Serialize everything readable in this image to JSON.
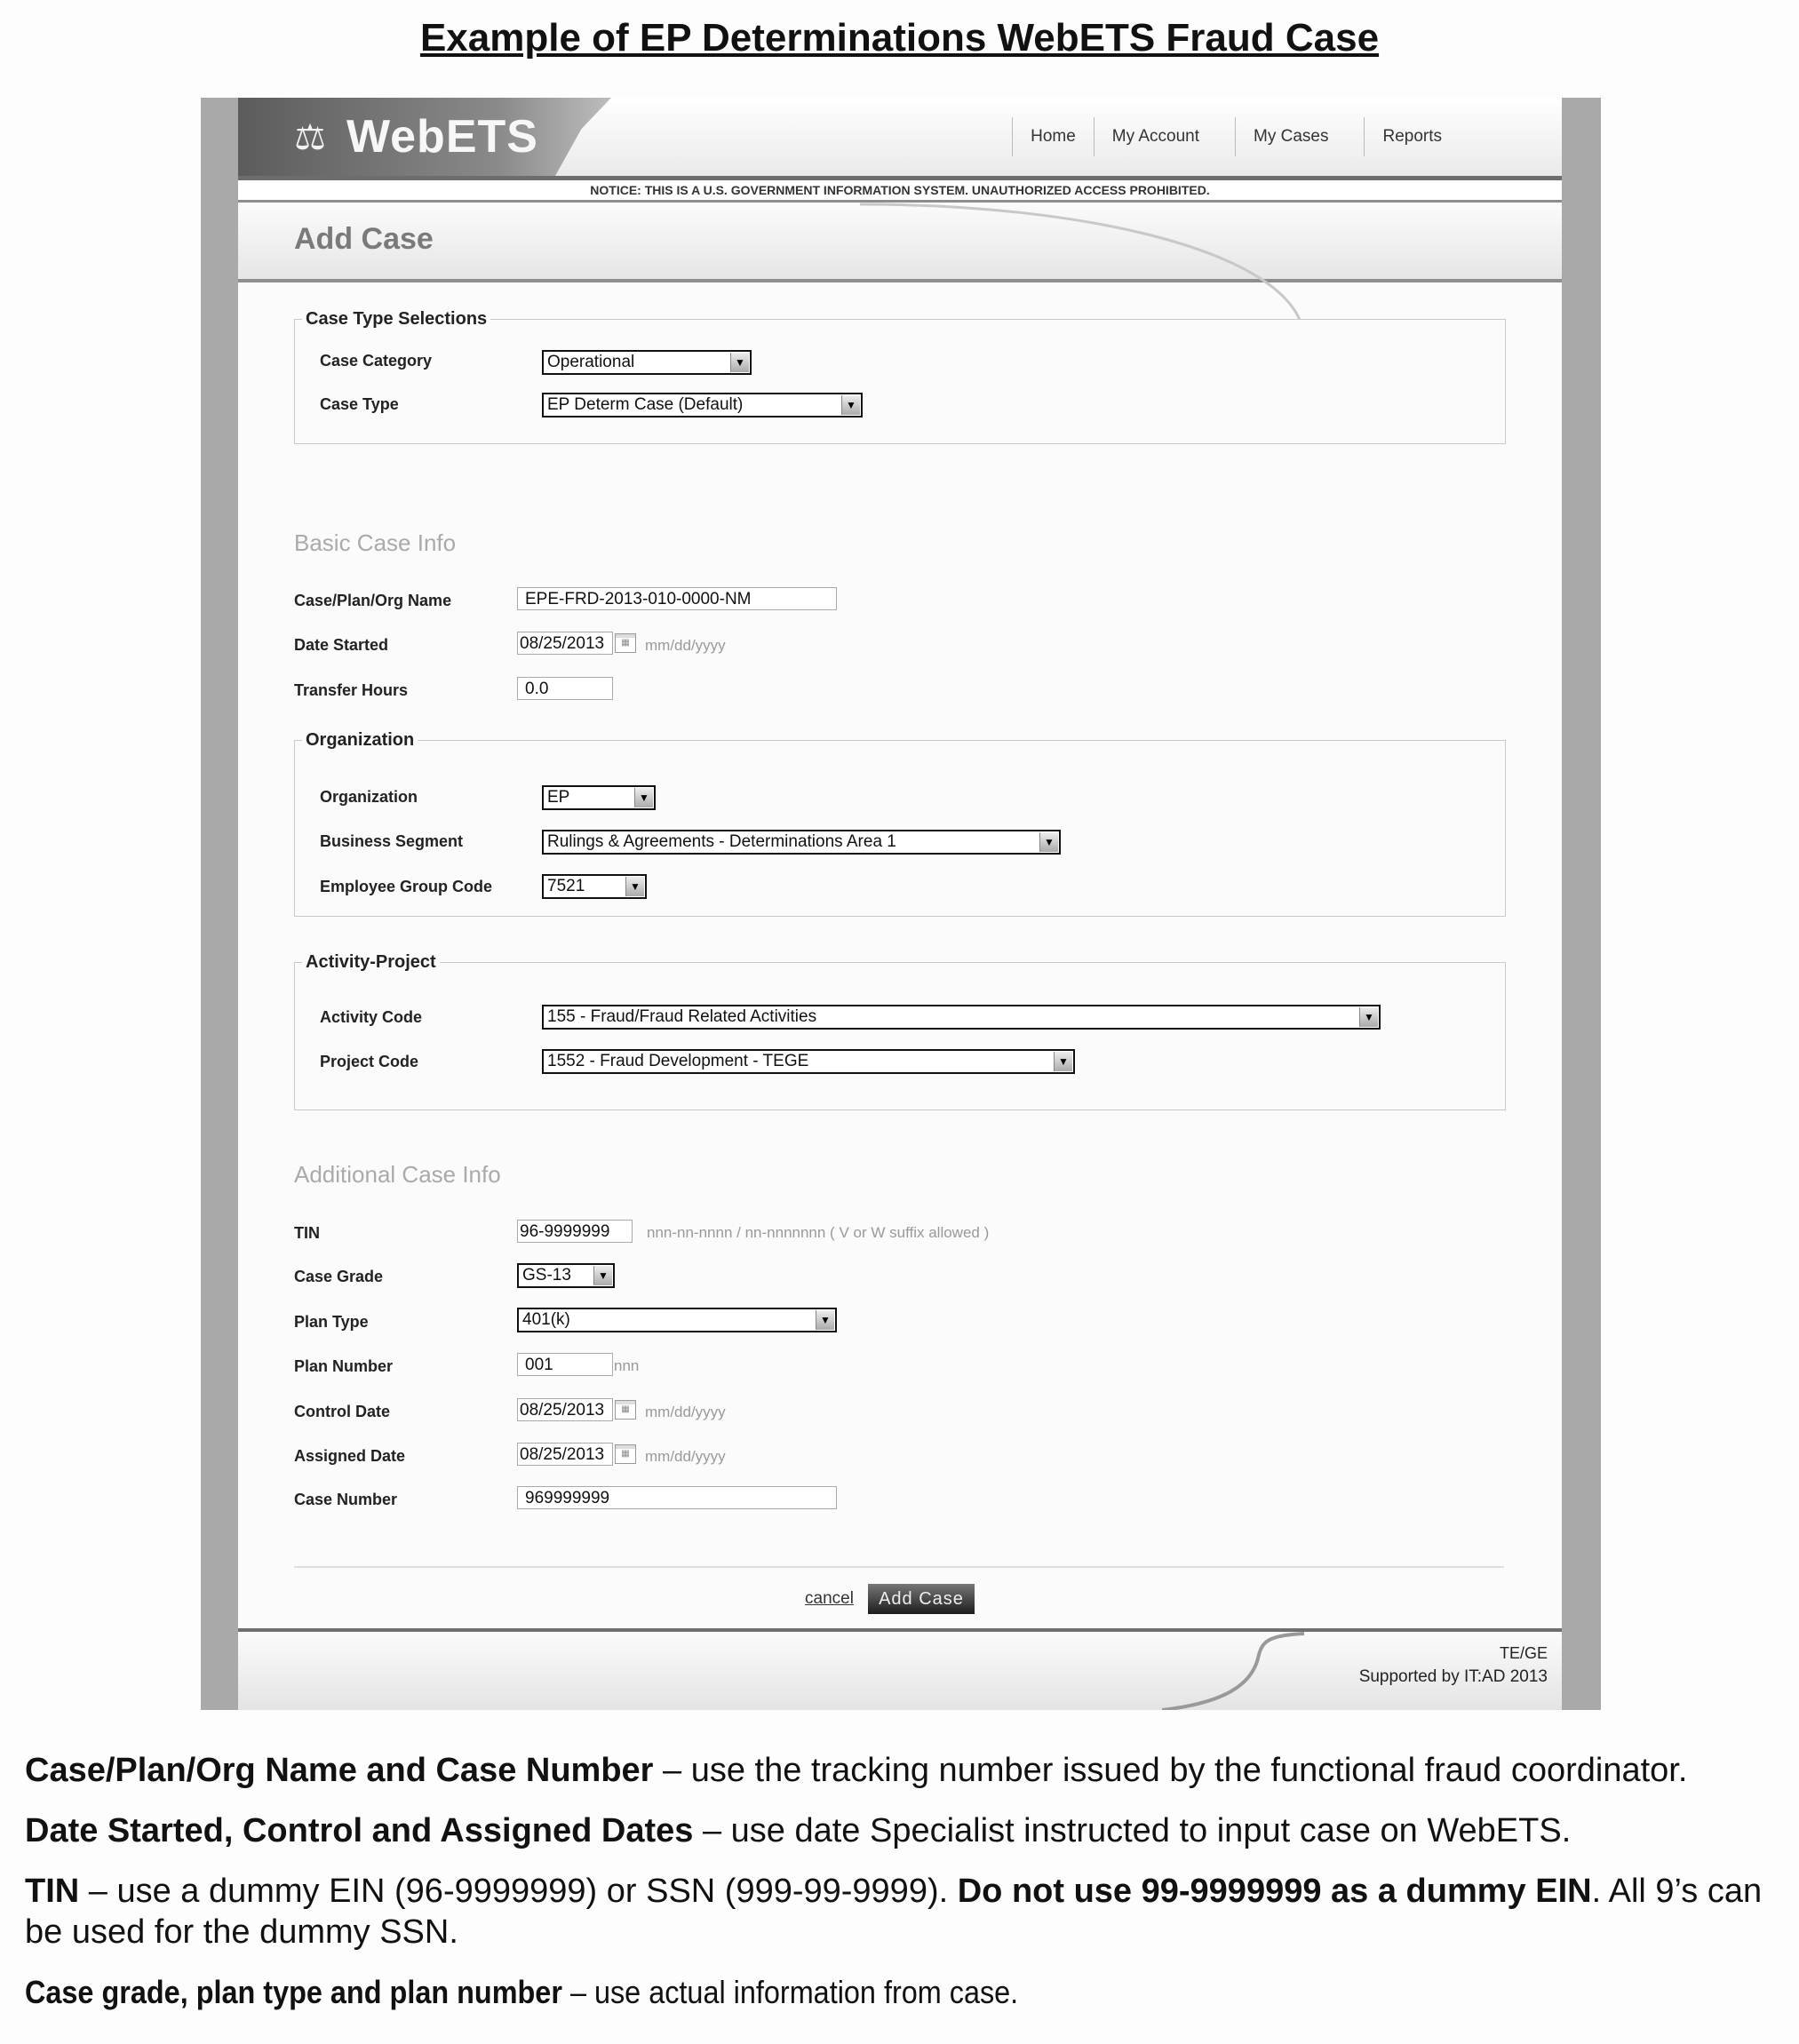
{
  "doc_title": "Example of EP Determinations WebETS Fraud Case",
  "app": {
    "logo_text": "WebETS",
    "nav": [
      "Home",
      "My Account",
      "My Cases",
      "Reports"
    ],
    "notice": "NOTICE: THIS IS A U.S. GOVERNMENT INFORMATION SYSTEM. UNAUTHORIZED ACCESS PROHIBITED.",
    "page_title": "Add Case"
  },
  "case_type_selections": {
    "legend": "Case Type Selections",
    "case_category": {
      "label": "Case Category",
      "value": "Operational"
    },
    "case_type": {
      "label": "Case Type",
      "value": "EP Determ Case (Default)"
    }
  },
  "basic_case_info": {
    "heading": "Basic Case Info",
    "name": {
      "label": "Case/Plan/Org Name",
      "value": "EPE-FRD-2013-010-0000-NM"
    },
    "date_started": {
      "label": "Date Started",
      "value": "08/25/2013",
      "hint": "mm/dd/yyyy"
    },
    "transfer_hours": {
      "label": "Transfer Hours",
      "value": "0.0"
    }
  },
  "organization": {
    "legend": "Organization",
    "organization": {
      "label": "Organization",
      "value": "EP"
    },
    "business_segment": {
      "label": "Business Segment",
      "value": "Rulings & Agreements - Determinations Area 1"
    },
    "employee_group_code": {
      "label": "Employee Group Code",
      "value": "7521"
    }
  },
  "activity_project": {
    "legend": "Activity-Project",
    "activity_code": {
      "label": "Activity Code",
      "value": "155 - Fraud/Fraud Related Activities"
    },
    "project_code": {
      "label": "Project Code",
      "value": "1552 - Fraud Development - TEGE"
    }
  },
  "additional_case_info": {
    "heading": "Additional Case Info",
    "tin": {
      "label": "TIN",
      "value": "96-9999999",
      "hint": "nnn-nn-nnnn / nn-nnnnnnn ( V or W suffix allowed )"
    },
    "case_grade": {
      "label": "Case Grade",
      "value": "GS-13"
    },
    "plan_type": {
      "label": "Plan Type",
      "value": "401(k)"
    },
    "plan_number": {
      "label": "Plan Number",
      "value": "001",
      "hint": "nnn"
    },
    "control_date": {
      "label": "Control Date",
      "value": "08/25/2013",
      "hint": "mm/dd/yyyy"
    },
    "assigned_date": {
      "label": "Assigned Date",
      "value": "08/25/2013",
      "hint": "mm/dd/yyyy"
    },
    "case_number": {
      "label": "Case Number",
      "value": "969999999"
    }
  },
  "actions": {
    "cancel": "cancel",
    "add_case": "Add Case"
  },
  "footer": {
    "org": "TE/GE",
    "supported": "Supported by IT:AD 2013"
  },
  "notes": {
    "n1_bold": "Case/Plan/Org Name and Case Number",
    "n1_text": " – use the tracking number issued by the functional fraud coordinator.",
    "n2_bold": "Date Started, Control and Assigned Dates",
    "n2_text": " – use date Specialist instructed to input case on WebETS.",
    "n3_bold": "TIN",
    "n3_text": " – use a dummy EIN (96-9999999) or SSN (999-99-9999). ",
    "n3_bold2": "Do not use 99-9999999 as a dummy EIN",
    "n3_text2": ". All 9’s can be used for the dummy SSN.",
    "n4_bold": "Case grade, plan type and plan number",
    "n4_text": " – use actual information from case."
  }
}
